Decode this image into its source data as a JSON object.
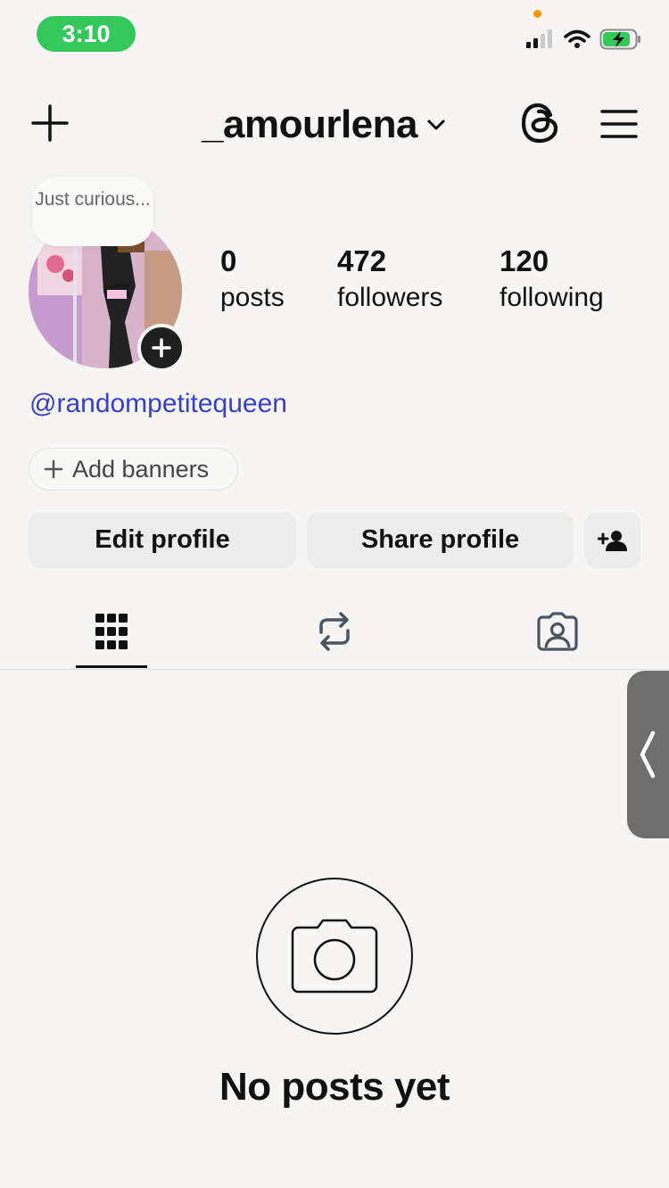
{
  "status_bar": {
    "time": "3:10"
  },
  "header": {
    "username": "_amourlena"
  },
  "profile": {
    "note": "Just curious...",
    "stats": [
      {
        "value": "0",
        "label": "posts"
      },
      {
        "value": "472",
        "label": "followers"
      },
      {
        "value": "120",
        "label": "following"
      }
    ],
    "link": "@randompetitequeen",
    "add_banners_label": "Add banners",
    "edit_profile_label": "Edit profile",
    "share_profile_label": "Share profile"
  },
  "tabs": [
    {
      "name": "grid",
      "active": true
    },
    {
      "name": "reposts",
      "active": false
    },
    {
      "name": "tagged",
      "active": false
    }
  ],
  "empty_state": {
    "title": "No posts yet"
  },
  "colors": {
    "time_pill": "#34c759",
    "link": "#3640c8",
    "background": "#f6f5f3",
    "button_bg": "#ececec"
  }
}
